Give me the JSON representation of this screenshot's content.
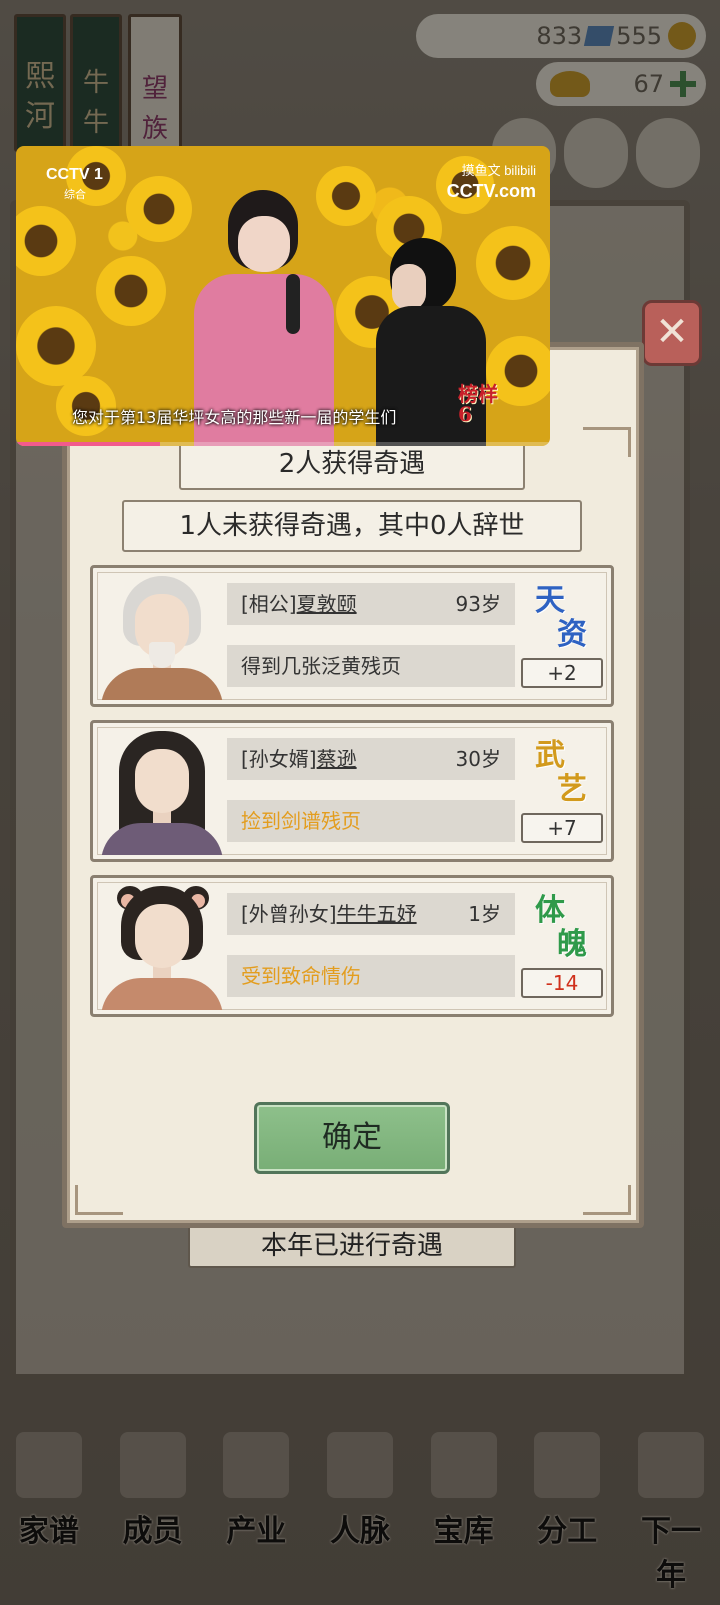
{
  "resources": {
    "silver": "833",
    "gems": "555",
    "gold": "67"
  },
  "background": {
    "tags": [
      "熙河",
      "牛牛氏",
      "望族"
    ],
    "bottom_nav": [
      "家谱",
      "成员",
      "产业",
      "人脉",
      "宝库",
      "分工",
      "下一年"
    ]
  },
  "dialog": {
    "headline": "2人获得奇遇",
    "subline": "1人未获得奇遇，其中0人辞世",
    "cards": [
      {
        "role": "[相公]",
        "name": "夏敦颐",
        "age": "93岁",
        "event": "得到几张泛黄残页",
        "event_color": "normal",
        "attr_ch1": "天",
        "attr_ch2": "资",
        "attr_color": "#2e62c2",
        "delta": "+2"
      },
      {
        "role": "[孙女婿]",
        "name": "蔡逊",
        "age": "30岁",
        "event": "捡到剑谱残页",
        "event_color": "orange",
        "attr_ch1": "武",
        "attr_ch2": "艺",
        "attr_color": "#d29a1c",
        "delta": "+7"
      },
      {
        "role": "[外曾孙女]",
        "name": "牛牛五妤",
        "age": "1岁",
        "event": "受到致命情伤",
        "event_color": "orange",
        "attr_ch1": "体",
        "attr_ch2": "魄",
        "attr_color": "#2f9a4a",
        "delta": "-14"
      }
    ],
    "confirm_label": "确定",
    "behind_label": "本年已进行奇遇"
  },
  "video": {
    "channel": "CCTV 1",
    "channel_sub": "综合",
    "top_right_1": "摸鱼文 bilibili",
    "top_right_2": "CCTV.com",
    "show_logo": "榜样6",
    "subtitle": "您对于第13届华坪女高的那些新一届的学生们",
    "progress": 0.27
  }
}
